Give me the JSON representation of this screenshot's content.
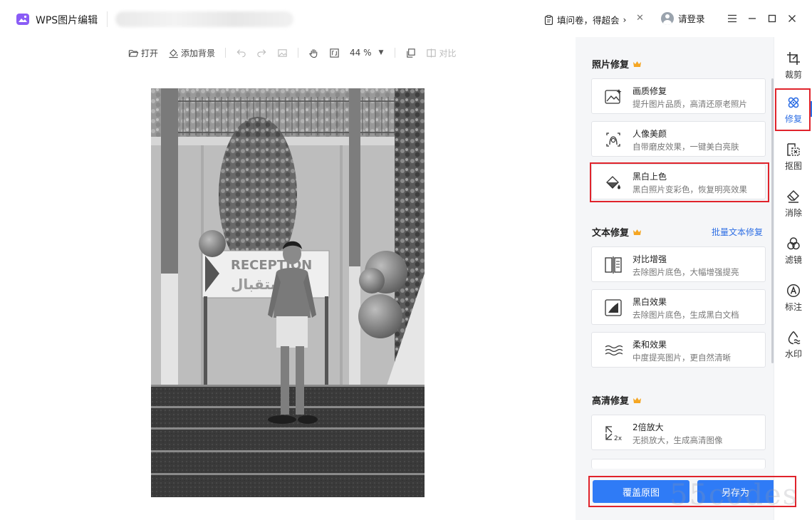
{
  "app": {
    "name": "WPS图片编辑"
  },
  "titlebar": {
    "survey_label": "填问卷，得超会",
    "login_label": "请登录"
  },
  "toolbar": {
    "open_label": "打开",
    "add_background_label": "添加背景",
    "zoom_value": "44 %",
    "compare_label": "对比"
  },
  "panel": {
    "photo_repair": {
      "title": "照片修复",
      "items": [
        {
          "title": "画质修复",
          "desc": "提升图片品质，高清还原老照片",
          "icon": "image-enhance-icon"
        },
        {
          "title": "人像美颜",
          "desc": "自带磨皮效果，一键美白亮肤",
          "icon": "face-beauty-icon"
        },
        {
          "title": "黑白上色",
          "desc": "黑白照片变彩色，恢复明亮效果",
          "icon": "paint-bucket-icon"
        }
      ]
    },
    "text_repair": {
      "title": "文本修复",
      "batch_link": "批量文本修复",
      "items": [
        {
          "title": "对比增强",
          "desc": "去除图片底色，大幅增强提亮",
          "icon": "contrast-icon"
        },
        {
          "title": "黑白效果",
          "desc": "去除图片底色，生成黑白文档",
          "icon": "bw-document-icon"
        },
        {
          "title": "柔和效果",
          "desc": "中度提亮图片，更自然清晰",
          "icon": "soft-waves-icon"
        }
      ]
    },
    "hd_repair": {
      "title": "高清修复",
      "items": [
        {
          "title": "2倍放大",
          "desc": "无损放大，生成高清图像",
          "icon": "upscale-2x-icon"
        }
      ]
    },
    "overwrite_label": "覆盖原图",
    "save_as_label": "另存为"
  },
  "rail": [
    {
      "label": "裁剪",
      "icon": "crop-icon"
    },
    {
      "label": "修复",
      "icon": "repair-icon",
      "active": true
    },
    {
      "label": "抠图",
      "icon": "cutout-icon"
    },
    {
      "label": "消除",
      "icon": "eraser-icon"
    },
    {
      "label": "滤镜",
      "icon": "filter-icon"
    },
    {
      "label": "标注",
      "icon": "annotate-icon"
    },
    {
      "label": "水印",
      "icon": "watermark-icon"
    }
  ],
  "colors": {
    "accent": "#2f7bf6",
    "highlight": "#e0232b",
    "crown": "#f5a623"
  },
  "photo": {
    "sign_text": "RECEPTION",
    "sign_arabic": "استقبال"
  },
  "watermark_text": "55codes"
}
